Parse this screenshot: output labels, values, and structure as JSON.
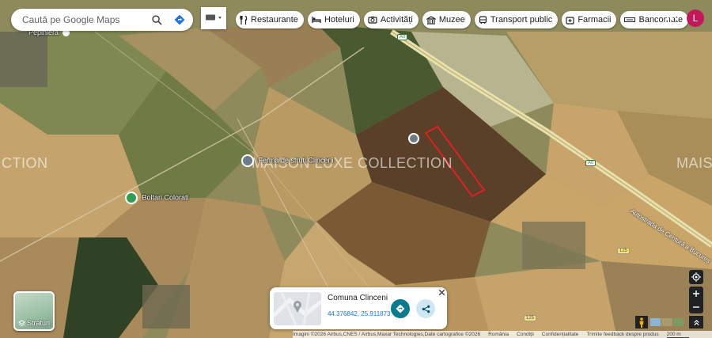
{
  "search": {
    "placeholder": "Caută pe Google Maps"
  },
  "chips": [
    {
      "icon": "restaurant-icon",
      "label": "Restaurante"
    },
    {
      "icon": "hotel-icon",
      "label": "Hoteluri"
    },
    {
      "icon": "camera-icon",
      "label": "Activități"
    },
    {
      "icon": "museum-icon",
      "label": "Muzee"
    },
    {
      "icon": "transit-icon",
      "label": "Transport public"
    },
    {
      "icon": "pharmacy-icon",
      "label": "Farmacii"
    },
    {
      "icon": "atm-icon",
      "label": "Bancomate"
    }
  ],
  "account": {
    "initial": "L",
    "color": "#c2185b"
  },
  "map": {
    "places": [
      {
        "name": "Pepinieră"
      },
      {
        "name": "Ferma de struti Clinceni"
      },
      {
        "name": "Boltari Colorati"
      }
    ],
    "watermark_center": "MAISON LUXE COLLECTION",
    "watermark_left": "CTION",
    "watermark_right": "MAIS",
    "road_label": "Autostrada de Centură a Bucureș",
    "shields": {
      "a0_top": "A0",
      "a0_mid": "A0",
      "r125_a": "125",
      "r125_b": "125"
    }
  },
  "layers": {
    "label": "Straturi"
  },
  "place_card": {
    "title": "Comuna Clinceni",
    "coords": "44.376842, 25.911873"
  },
  "attribution": {
    "imagery": "Imagini ©2026 Airbus,CNES / Airbus,Maxar Technologies,Date cartografice ©2026",
    "country": "România",
    "terms": "Condiții",
    "privacy": "Confidențialitate",
    "feedback": "Trimite feedback despre produs",
    "scale": "200 m"
  },
  "colors": {
    "accent": "#1a73e8",
    "parcel_outline": "#e02020",
    "direction_button": "#0b7a8f"
  }
}
